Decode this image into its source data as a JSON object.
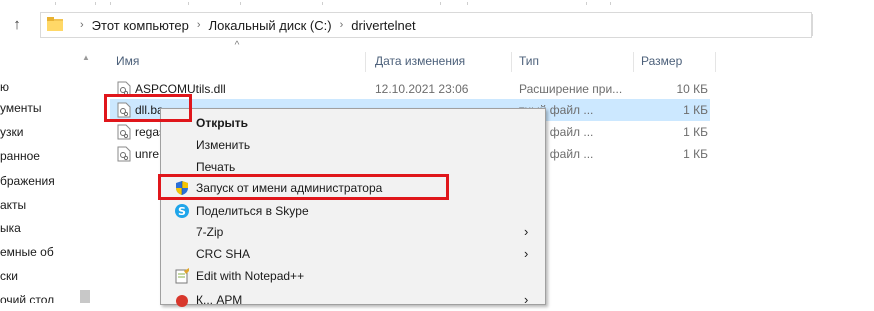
{
  "address_bar": {
    "crumbs": [
      "Этот компьютер",
      "Локальный диск (C:)",
      "drivertelnet"
    ],
    "separator": "›"
  },
  "nav": {
    "items": [
      "ю",
      "ументы",
      "узки",
      "ранное",
      "бражения",
      "акты",
      "ыка",
      "емные об",
      "ски",
      "очий стол"
    ]
  },
  "file_list": {
    "headers": {
      "name": "Имя",
      "date": "Дата изменения",
      "type": "Тип",
      "size": "Размер"
    },
    "rows": [
      {
        "name": "ASPCOMUtils.dll",
        "date": "12.10.2021 23:06",
        "type": "Расширение при...",
        "size": "10 КБ",
        "selected": false
      },
      {
        "name": "dll.ba",
        "date": "",
        "type": "тный файл ...",
        "size": "1 КБ",
        "selected": true
      },
      {
        "name": "regas",
        "date": "",
        "type": "тный файл ...",
        "size": "1 КБ",
        "selected": false
      },
      {
        "name": "unre",
        "date": "",
        "type": "тный файл ...",
        "size": "1 КБ",
        "selected": false
      }
    ]
  },
  "context_menu": {
    "open": "Открыть",
    "edit": "Изменить",
    "print": "Печать",
    "run_as_admin": "Запуск от имени администратора",
    "share_skype": "Поделиться в Skype",
    "seven_zip": "7-Zip",
    "crc_sha": "CRC SHA",
    "notepadpp": "Edit with Notepad++",
    "partial_item": "К... АРМ"
  },
  "colors": {
    "highlight_border": "#e0161b",
    "selection": "#cce8ff",
    "menu_bg": "#f2f2f2",
    "header_text": "#4c607a"
  },
  "icons": {
    "up": "up-arrow-icon",
    "folder": "folder-icon",
    "file": "file-icon",
    "shield": "uac-shield-icon",
    "skype": "skype-icon",
    "notepad": "notepad-icon",
    "submenu": "chevron-right-icon"
  }
}
